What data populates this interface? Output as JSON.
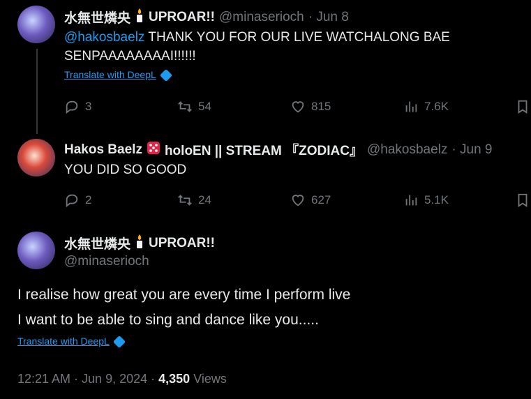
{
  "tweet1": {
    "display_name": "水無世燐央",
    "name_suffix": "UPROAR!!",
    "handle": "@minaserioch",
    "date": "· Jun 8",
    "mention": "@hakosbaelz",
    "text": " THANK YOU FOR OUR LIVE WATCHALONG BAE SENPAAAAAAAAI!!!!!!",
    "translate": "Translate with DeepL",
    "replies": "3",
    "retweets": "54",
    "likes": "815",
    "views": "7.6K"
  },
  "tweet2": {
    "display_name": "Hakos Baelz",
    "name_suffix": "holoEN || STREAM 『ZODIAC』",
    "handle": "@hakosbaelz",
    "date": "· Jun 9",
    "text": "YOU DID SO GOOD",
    "replies": "2",
    "retweets": "24",
    "likes": "627",
    "views": "5.1K"
  },
  "main": {
    "display_name": "水無世燐央",
    "name_suffix": "UPROAR!!",
    "handle": "@minaserioch",
    "line1": "I realise how great you are every time I perform live",
    "line2": "I want to be able to sing and dance like you.....",
    "translate": "Translate with DeepL",
    "time": "12:21 AM · Jun 9, 2024 · ",
    "views_count": "4,350",
    "views_label": " Views"
  },
  "colors": {
    "accent": "#1d9bf0",
    "muted": "#71767b",
    "text": "#e7e9ea",
    "background": "#000000"
  },
  "icons": [
    "reply-icon",
    "retweet-icon",
    "like-icon",
    "views-icon",
    "bookmark-icon",
    "candle-emoji",
    "die-emoji",
    "deepl-icon"
  ]
}
